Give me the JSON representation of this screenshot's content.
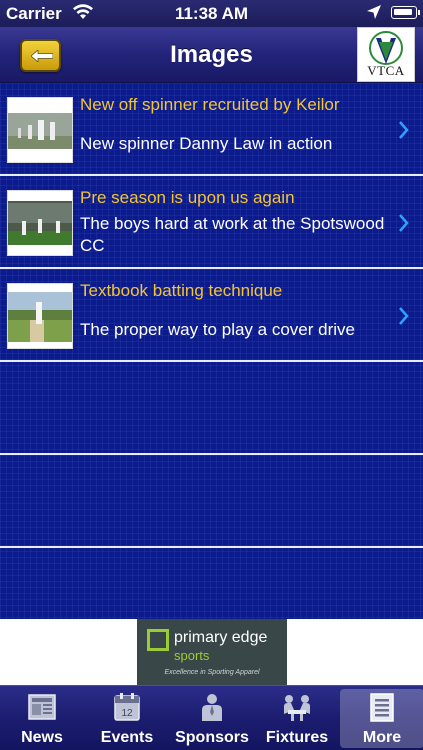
{
  "status_bar": {
    "carrier": "Carrier",
    "time": "11:38 AM"
  },
  "navbar": {
    "title": "Images",
    "logo_text": "VTCA"
  },
  "items": [
    {
      "title": "New off spinner recruited by Keilor",
      "subtitle": "New spinner Danny Law in action"
    },
    {
      "title": "Pre season is upon us again",
      "subtitle": "The boys hard at work at the Spotswood CC"
    },
    {
      "title": "Textbook batting technique",
      "subtitle": "The proper way to play a cover drive"
    }
  ],
  "ad": {
    "line1": "primary edge",
    "line2": "sports",
    "tagline": "Excellence in Sporting Apparel"
  },
  "tabs": [
    {
      "label": "News",
      "icon": "newspaper-icon"
    },
    {
      "label": "Events",
      "icon": "calendar-icon"
    },
    {
      "label": "Sponsors",
      "icon": "person-icon"
    },
    {
      "label": "Fixtures",
      "icon": "meeting-icon"
    },
    {
      "label": "More",
      "icon": "list-icon",
      "active": true
    }
  ],
  "colors": {
    "accent_yellow": "#f4c431",
    "background_blue": "#0c1b8c",
    "chevron": "#2ea0ff"
  }
}
